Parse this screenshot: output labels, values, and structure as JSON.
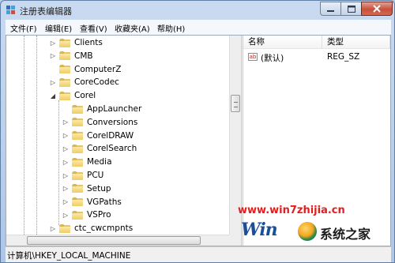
{
  "window": {
    "title": "注册表编辑器"
  },
  "menu": [
    "文件(F)",
    "编辑(E)",
    "查看(V)",
    "收藏夹(A)",
    "帮助(H)"
  ],
  "tree": [
    {
      "label": "Clients",
      "arrow": "▷",
      "level": 0
    },
    {
      "label": "CMB",
      "arrow": "▷",
      "level": 0
    },
    {
      "label": "ComputerZ",
      "arrow": "",
      "level": 0
    },
    {
      "label": "CoreCodec",
      "arrow": "▷",
      "level": 0
    },
    {
      "label": "Corel",
      "arrow": "◢",
      "level": 0
    },
    {
      "label": "AppLauncher",
      "arrow": "",
      "level": 1
    },
    {
      "label": "Conversions",
      "arrow": "▷",
      "level": 1
    },
    {
      "label": "CorelDRAW",
      "arrow": "▷",
      "level": 1
    },
    {
      "label": "CorelSearch",
      "arrow": "▷",
      "level": 1
    },
    {
      "label": "Media",
      "arrow": "▷",
      "level": 1
    },
    {
      "label": "PCU",
      "arrow": "▷",
      "level": 1
    },
    {
      "label": "Setup",
      "arrow": "▷",
      "level": 1
    },
    {
      "label": "VGPaths",
      "arrow": "▷",
      "level": 1
    },
    {
      "label": "VSPro",
      "arrow": "▷",
      "level": 1
    },
    {
      "label": "ctc_cwcmpnts",
      "arrow": "▷",
      "level": 0
    }
  ],
  "values": {
    "columns": {
      "name": "名称",
      "type": "类型"
    },
    "rows": [
      {
        "icon": "ab",
        "name": "(默认)",
        "type": "REG_SZ"
      }
    ]
  },
  "watermark": {
    "url": "www.win7zhijia.cn",
    "logo_mark": "Win",
    "logo_text": "系统之家"
  },
  "status": {
    "path": "计算机\\HKEY_LOCAL_MACHINE"
  }
}
